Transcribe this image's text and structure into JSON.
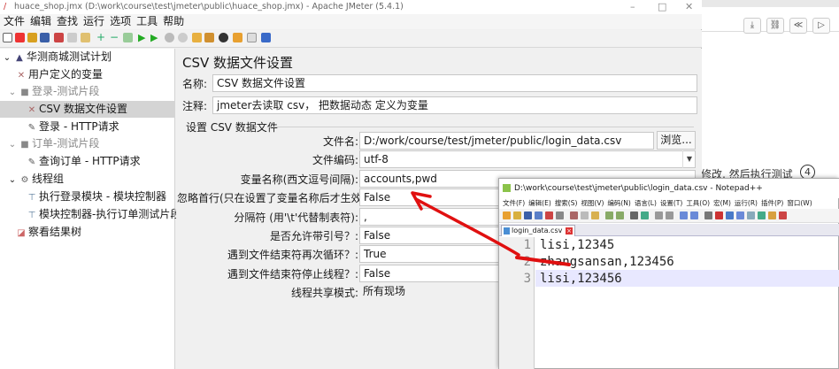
{
  "window": {
    "title": "huace_shop.jmx (D:\\work\\course\\test\\jmeter\\public\\huace_shop.jmx) - Apache JMeter (5.4.1)",
    "min": "–",
    "max": "□",
    "close": "✕"
  },
  "menu": [
    "文件",
    "编辑",
    "查找",
    "运行",
    "选项",
    "工具",
    "帮助"
  ],
  "tree": {
    "plan": "华测商城测试计划",
    "uservars": "用户定义的变量",
    "login_frag": "登录-测试片段",
    "csv": "CSV 数据文件设置",
    "login_http": "登录 - HTTP请求",
    "order_frag": "订单-测试片段",
    "order_http": "查询订单 - HTTP请求",
    "threadgroup": "线程组",
    "exec_login": "执行登录模块 - 模块控制器",
    "module_ctrl": "模块控制器-执行订单测试片段",
    "results": "察看结果树"
  },
  "panel": {
    "heading": "CSV 数据文件设置",
    "name_label": "名称:",
    "name_value": "CSV 数据文件设置",
    "comment_label": "注释:",
    "comment_value": "jmeter去读取 csv， 把数据动态 定义为变量",
    "section": "设置 CSV 数据文件",
    "filename_label": "文件名:",
    "filename_value": "D:/work/course/test/jmeter/public/login_data.csv",
    "browse": "浏览...",
    "encoding_label": "文件编码:",
    "encoding_value": "utf-8",
    "varnames_label": "变量名称(西文逗号间隔):",
    "varnames_value": "accounts,pwd",
    "ignore_label": "忽略首行(只在设置了变量名称后才生效):",
    "ignore_value": "False",
    "delim_label": "分隔符 (用'\\t'代替制表符):",
    "delim_value": ",",
    "quoted_label": "是否允许带引号？:",
    "quoted_value": "False",
    "recycle_label": "遇到文件结束符再次循环？:",
    "recycle_value": "True",
    "stop_label": "遇到文件结束符停止线程？:",
    "stop_value": "False",
    "share_label": "线程共享模式:",
    "share_value": "所有现场"
  },
  "background": {
    "text": "修改, 然后执行测试",
    "num": "4",
    "buttons": [
      "⤓",
      "⛓",
      "≪",
      "▷"
    ]
  },
  "notepad": {
    "title": "D:\\work\\course\\test\\jmeter\\public\\login_data.csv - Notepad++",
    "menu": [
      "文件(F)",
      "编辑(E)",
      "搜索(S)",
      "视图(V)",
      "编码(N)",
      "语言(L)",
      "设置(T)",
      "工具(O)",
      "宏(M)",
      "运行(R)",
      "插件(P)",
      "窗口(W)"
    ],
    "tab": "login_data.csv",
    "lines": [
      {
        "n": "1",
        "text": "lisi,12345"
      },
      {
        "n": "2",
        "text": "zhangsansan,123456"
      },
      {
        "n": "3",
        "text": "lisi,123456"
      }
    ]
  },
  "colors": {
    "annotation": "#e01010",
    "selected": "#d4d4d4"
  }
}
